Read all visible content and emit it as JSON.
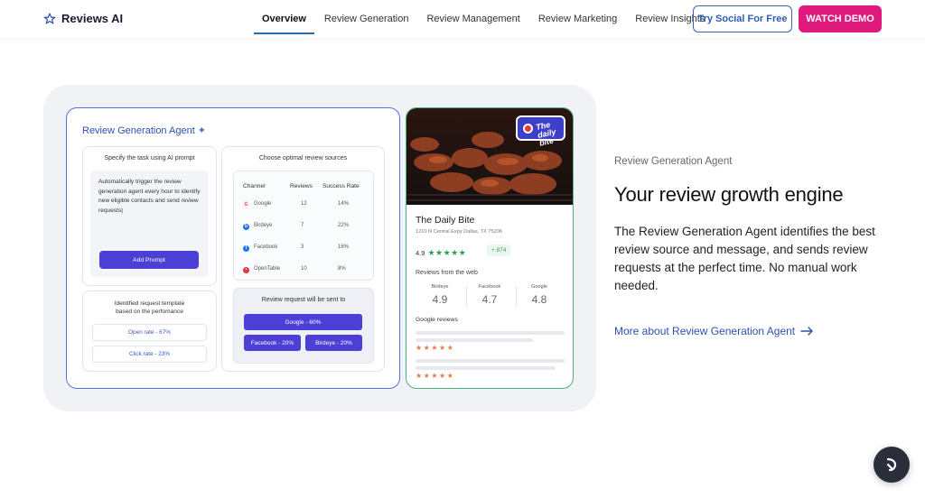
{
  "brand": {
    "name": "Reviews AI"
  },
  "nav": {
    "links": [
      "Overview",
      "Review Generation",
      "Review Management",
      "Review Marketing",
      "Review Insights"
    ],
    "active": "Overview",
    "try_label": "Try Social For Free",
    "demo_label": "WATCH DEMO"
  },
  "agent_card": {
    "title": "Review Generation Agent",
    "prompt_box": {
      "title": "Specify the task using AI prompt",
      "text": "Automatically trigger the review generation agent every hour to identify new eligible contacts and send review requests|",
      "button": "Add Prompt"
    },
    "sources_box": {
      "title": "Choose optimal review sources",
      "headers": [
        "Channel",
        "Reviews",
        "Success Rate"
      ],
      "rows": [
        {
          "channel": "Google",
          "reviews": "12",
          "rate": "14%",
          "icon": "google-icon",
          "color": "#ea4335"
        },
        {
          "channel": "Birdeye",
          "reviews": "7",
          "rate": "22%",
          "icon": "birdeye-icon",
          "color": "#1d6fe6"
        },
        {
          "channel": "Facebook",
          "reviews": "3",
          "rate": "16%",
          "icon": "facebook-icon",
          "color": "#1877f2"
        },
        {
          "channel": "OpenTable",
          "reviews": "10",
          "rate": "8%",
          "icon": "opentable-icon",
          "color": "#da3743"
        }
      ]
    },
    "sent_box": {
      "title": "Review request will be sent to",
      "pills": [
        "Google - 60%",
        "Facebook - 20%",
        "Birdeye - 20%"
      ]
    },
    "template_box": {
      "title_line1": "Identified request template",
      "title_line2": "based on the perfomance",
      "open_rate": "Open rate - 67%",
      "click_rate": "Click rate - 23%"
    }
  },
  "business": {
    "badge_text": "The daily bite",
    "name": "The Daily Bite",
    "address": "1210 N Central Expy Dallas, TX 75206",
    "rating": "4.9",
    "stars": "★★★★★",
    "new_reviews": "+ 874",
    "web_title": "Reviews from the web",
    "web": [
      {
        "name": "Birdeye",
        "value": "4.9"
      },
      {
        "name": "Facebook",
        "value": "4.7"
      },
      {
        "name": "Google",
        "value": "4.8"
      }
    ],
    "google_reviews_title": "Google reviews",
    "review_stars": "★★★★★"
  },
  "hero": {
    "eyebrow": "Review Generation Agent",
    "headline": "Your review growth engine",
    "description": "The Review Generation Agent identifies the best review source and message, and sends review requests at the perfect time. No manual work needed.",
    "link": "More about Review Generation Agent"
  },
  "colors": {
    "accent": "#4b3fd6",
    "pink": "#e0197d",
    "link": "#2f4fb0"
  }
}
